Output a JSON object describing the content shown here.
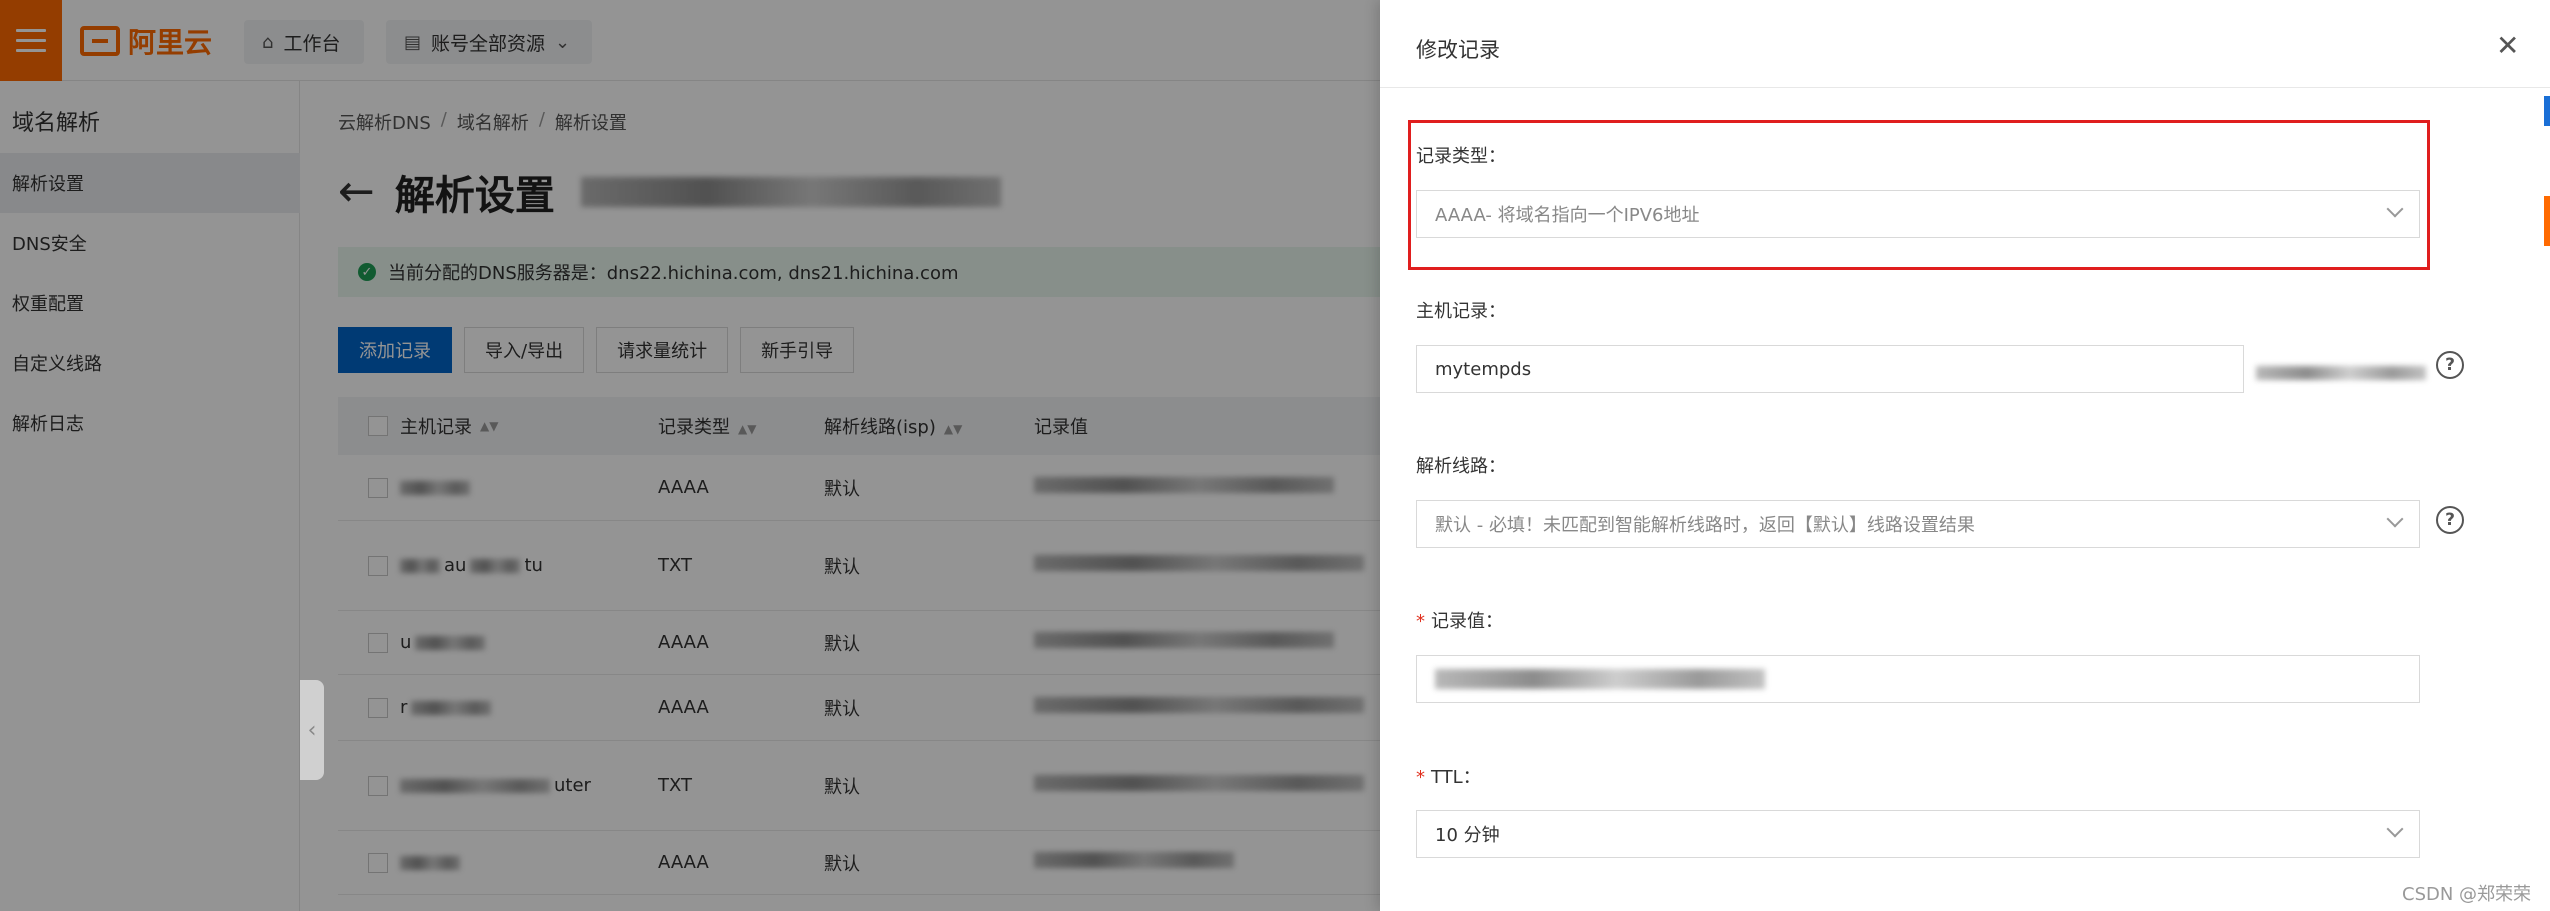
{
  "topbar": {
    "brand": "阿里云",
    "workbench": "工作台",
    "resources": "账号全部资源"
  },
  "sidebar": {
    "title": "域名解析",
    "items": [
      {
        "label": "解析设置",
        "active": true
      },
      {
        "label": "DNS安全",
        "active": false
      },
      {
        "label": "权重配置",
        "active": false
      },
      {
        "label": "自定义线路",
        "active": false
      },
      {
        "label": "解析日志",
        "active": false
      }
    ]
  },
  "breadcrumb": [
    "云解析DNS",
    "域名解析",
    "解析设置"
  ],
  "page": {
    "title": "解析设置",
    "notice": "当前分配的DNS服务器是：dns22.hichina.com, dns21.hichina.com"
  },
  "toolbar": {
    "add": "添加记录",
    "import_export": "导入/导出",
    "stats": "请求量统计",
    "guide": "新手引导"
  },
  "table": {
    "headers": [
      "主机记录",
      "记录类型",
      "解析线路(isp)",
      "记录值"
    ],
    "rows": [
      {
        "host": "",
        "type": "AAAA",
        "line": "默认"
      },
      {
        "host": "au",
        "host_suffix": "tu",
        "type": "TXT",
        "line": "默认"
      },
      {
        "host": "u",
        "type": "AAAA",
        "line": "默认"
      },
      {
        "host": "r",
        "type": "AAAA",
        "line": "默认"
      },
      {
        "host": "",
        "host_suffix": "uter",
        "type": "TXT",
        "line": "默认"
      },
      {
        "host": "",
        "type": "AAAA",
        "line": "默认"
      }
    ]
  },
  "drawer": {
    "title": "修改记录",
    "record_type": {
      "label": "记录类型：",
      "value": "AAAA- 将域名指向一个IPV6地址"
    },
    "host": {
      "label": "主机记录：",
      "value": "mytempds"
    },
    "line": {
      "label": "解析线路：",
      "value": "默认 - 必填！未匹配到智能解析线路时，返回【默认】线路设置结果"
    },
    "record_value": {
      "label": "记录值："
    },
    "ttl": {
      "label": "TTL：",
      "value": "10 分钟"
    },
    "help_glyph": "?"
  },
  "watermark": "CSDN @郑荣荣",
  "colors": {
    "brand_orange": "#ff6a00",
    "primary_blue": "#0064c8",
    "highlight_red": "#e01e1e"
  }
}
